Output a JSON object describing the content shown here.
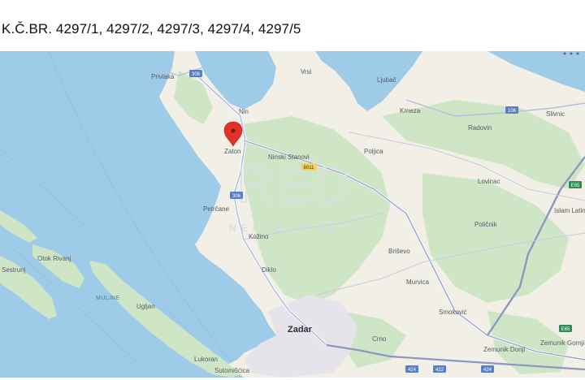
{
  "page": {
    "title": "K.Č.BR. 4297/1, 4297/2, 4297/3, 4297/4, 4297/5"
  },
  "map": {
    "icons": {
      "marker": "map-pin-icon",
      "menu": "more-dots-icon"
    },
    "colors": {
      "sea": "#9ecbe8",
      "land": "#f1efe6",
      "forest": "#cfe6c6",
      "urban": "#e8e6ea",
      "road": "#8e96c2",
      "marker": "#e0322b"
    },
    "watermark": {
      "main": "RED",
      "sub": "NEKRETNINE"
    },
    "labels": {
      "privlaka": "Privlaka",
      "vrsi": "Vrsi",
      "ljubac": "Ljubač",
      "nin": "Nin",
      "krneza": "Krneza",
      "radovin": "Radovin",
      "slivnic": "Slivnic",
      "zaton": "Zaton",
      "ninski_stanovi": "Ninski Stanovi",
      "poljica": "Poljica",
      "lovinac": "Lovinac",
      "islam_latin": "Islam Latins",
      "policnik": "Poličnik",
      "petrcane": "Petrčane",
      "kozino": "Kožino",
      "brisevo": "Briševo",
      "otok_rivanj": "Otok Rivanj",
      "sestrunj": "Sestrunj",
      "diklo": "Diklo",
      "murvica": "Murvica",
      "muline": "MULINE",
      "ugljan": "Ugljan",
      "smokovic": "Smoković",
      "zadar": "Zadar",
      "crno": "Crno",
      "zemunik_donji": "Zemunik Donji",
      "zemunik_gornji": "Zemunik Gornji",
      "lukoran": "Lukoran",
      "sutomiscica": "Sutomišćica"
    },
    "shields": {
      "r306a": "306",
      "r306b": "306",
      "r106": "106",
      "e65a": "E65",
      "r8011": "8011",
      "e65b": "E65",
      "r424a": "424",
      "r424b": "424",
      "r422": "422"
    }
  }
}
